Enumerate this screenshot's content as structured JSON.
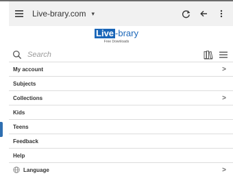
{
  "browser": {
    "site": "Live-brary.com",
    "icons": {
      "menu": "hamburger-menu-icon",
      "dropdown": "caret-down-icon",
      "reload": "reload-icon",
      "back": "back-arrow-icon",
      "more": "vertical-dots-icon"
    }
  },
  "logo": {
    "live": "Live",
    "rest": "-brary",
    "tagline": "Free Downloads"
  },
  "search": {
    "placeholder": "Search"
  },
  "nav": {
    "items": [
      {
        "label": "My account",
        "has_chevron": true
      },
      {
        "label": "Subjects",
        "has_chevron": false
      },
      {
        "label": "Collections",
        "has_chevron": true
      },
      {
        "label": "Kids",
        "has_chevron": false
      },
      {
        "label": "Teens",
        "has_chevron": false
      },
      {
        "label": "Feedback",
        "has_chevron": false
      },
      {
        "label": "Help",
        "has_chevron": false
      },
      {
        "label": "Language",
        "has_chevron": true,
        "icon": "globe-icon"
      }
    ],
    "chevron_glyph": ">"
  },
  "colors": {
    "brand_blue": "#1a66b8",
    "toolbar_bg": "#f1f1f1",
    "divider": "#dcdcdc"
  }
}
